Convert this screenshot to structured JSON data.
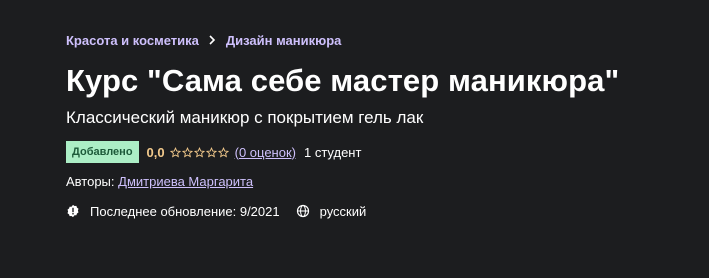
{
  "breadcrumb": {
    "items": [
      {
        "label": "Красота и косметика"
      },
      {
        "label": "Дизайн маникюра"
      }
    ],
    "separator_icon": "chevron-right-icon"
  },
  "course": {
    "title": "Курс \"Сама себе мастер маникюра\"",
    "subtitle": "Классический маникюр с покрытием гель лак",
    "badge": "Добавлено",
    "rating_value": "0,0",
    "stars_filled": 0,
    "stars_total": 5,
    "reviews_link": "(0 оценок)",
    "students": "1 студент",
    "authors_label": "Авторы:",
    "author_name": "Дмитриева Маргарита",
    "updated_icon": "alert-badge-icon",
    "updated": "Последнее обновление: 9/2021",
    "language_icon": "globe-icon",
    "language": "русский"
  },
  "colors": {
    "background": "#1c1d1f",
    "link": "#cec0fc",
    "rating": "#f3ca8c",
    "badge_bg": "#aceec6",
    "badge_text": "#1d5a3a"
  }
}
